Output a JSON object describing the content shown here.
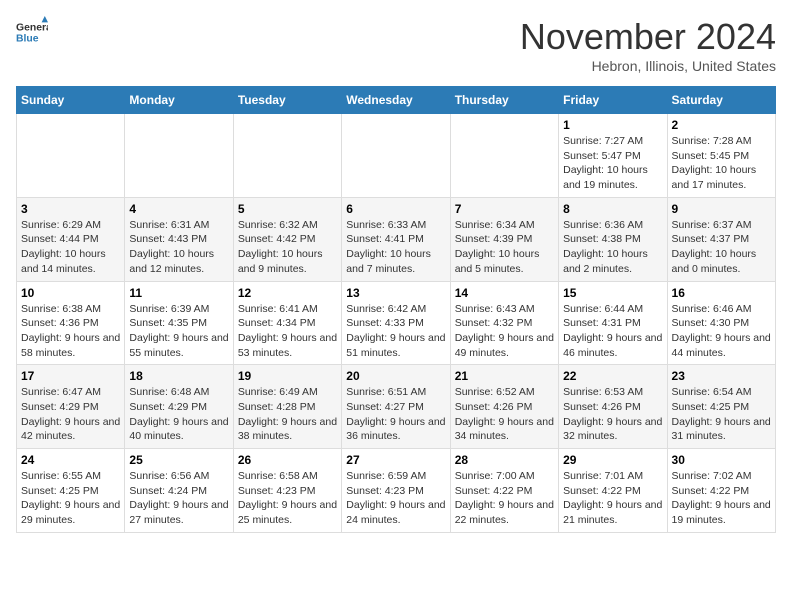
{
  "header": {
    "logo_general": "General",
    "logo_blue": "Blue",
    "month_title": "November 2024",
    "location": "Hebron, Illinois, United States"
  },
  "days_of_week": [
    "Sunday",
    "Monday",
    "Tuesday",
    "Wednesday",
    "Thursday",
    "Friday",
    "Saturday"
  ],
  "weeks": [
    [
      {
        "day": "",
        "info": ""
      },
      {
        "day": "",
        "info": ""
      },
      {
        "day": "",
        "info": ""
      },
      {
        "day": "",
        "info": ""
      },
      {
        "day": "",
        "info": ""
      },
      {
        "day": "1",
        "info": "Sunrise: 7:27 AM\nSunset: 5:47 PM\nDaylight: 10 hours and 19 minutes."
      },
      {
        "day": "2",
        "info": "Sunrise: 7:28 AM\nSunset: 5:45 PM\nDaylight: 10 hours and 17 minutes."
      }
    ],
    [
      {
        "day": "3",
        "info": "Sunrise: 6:29 AM\nSunset: 4:44 PM\nDaylight: 10 hours and 14 minutes."
      },
      {
        "day": "4",
        "info": "Sunrise: 6:31 AM\nSunset: 4:43 PM\nDaylight: 10 hours and 12 minutes."
      },
      {
        "day": "5",
        "info": "Sunrise: 6:32 AM\nSunset: 4:42 PM\nDaylight: 10 hours and 9 minutes."
      },
      {
        "day": "6",
        "info": "Sunrise: 6:33 AM\nSunset: 4:41 PM\nDaylight: 10 hours and 7 minutes."
      },
      {
        "day": "7",
        "info": "Sunrise: 6:34 AM\nSunset: 4:39 PM\nDaylight: 10 hours and 5 minutes."
      },
      {
        "day": "8",
        "info": "Sunrise: 6:36 AM\nSunset: 4:38 PM\nDaylight: 10 hours and 2 minutes."
      },
      {
        "day": "9",
        "info": "Sunrise: 6:37 AM\nSunset: 4:37 PM\nDaylight: 10 hours and 0 minutes."
      }
    ],
    [
      {
        "day": "10",
        "info": "Sunrise: 6:38 AM\nSunset: 4:36 PM\nDaylight: 9 hours and 58 minutes."
      },
      {
        "day": "11",
        "info": "Sunrise: 6:39 AM\nSunset: 4:35 PM\nDaylight: 9 hours and 55 minutes."
      },
      {
        "day": "12",
        "info": "Sunrise: 6:41 AM\nSunset: 4:34 PM\nDaylight: 9 hours and 53 minutes."
      },
      {
        "day": "13",
        "info": "Sunrise: 6:42 AM\nSunset: 4:33 PM\nDaylight: 9 hours and 51 minutes."
      },
      {
        "day": "14",
        "info": "Sunrise: 6:43 AM\nSunset: 4:32 PM\nDaylight: 9 hours and 49 minutes."
      },
      {
        "day": "15",
        "info": "Sunrise: 6:44 AM\nSunset: 4:31 PM\nDaylight: 9 hours and 46 minutes."
      },
      {
        "day": "16",
        "info": "Sunrise: 6:46 AM\nSunset: 4:30 PM\nDaylight: 9 hours and 44 minutes."
      }
    ],
    [
      {
        "day": "17",
        "info": "Sunrise: 6:47 AM\nSunset: 4:29 PM\nDaylight: 9 hours and 42 minutes."
      },
      {
        "day": "18",
        "info": "Sunrise: 6:48 AM\nSunset: 4:29 PM\nDaylight: 9 hours and 40 minutes."
      },
      {
        "day": "19",
        "info": "Sunrise: 6:49 AM\nSunset: 4:28 PM\nDaylight: 9 hours and 38 minutes."
      },
      {
        "day": "20",
        "info": "Sunrise: 6:51 AM\nSunset: 4:27 PM\nDaylight: 9 hours and 36 minutes."
      },
      {
        "day": "21",
        "info": "Sunrise: 6:52 AM\nSunset: 4:26 PM\nDaylight: 9 hours and 34 minutes."
      },
      {
        "day": "22",
        "info": "Sunrise: 6:53 AM\nSunset: 4:26 PM\nDaylight: 9 hours and 32 minutes."
      },
      {
        "day": "23",
        "info": "Sunrise: 6:54 AM\nSunset: 4:25 PM\nDaylight: 9 hours and 31 minutes."
      }
    ],
    [
      {
        "day": "24",
        "info": "Sunrise: 6:55 AM\nSunset: 4:25 PM\nDaylight: 9 hours and 29 minutes."
      },
      {
        "day": "25",
        "info": "Sunrise: 6:56 AM\nSunset: 4:24 PM\nDaylight: 9 hours and 27 minutes."
      },
      {
        "day": "26",
        "info": "Sunrise: 6:58 AM\nSunset: 4:23 PM\nDaylight: 9 hours and 25 minutes."
      },
      {
        "day": "27",
        "info": "Sunrise: 6:59 AM\nSunset: 4:23 PM\nDaylight: 9 hours and 24 minutes."
      },
      {
        "day": "28",
        "info": "Sunrise: 7:00 AM\nSunset: 4:22 PM\nDaylight: 9 hours and 22 minutes."
      },
      {
        "day": "29",
        "info": "Sunrise: 7:01 AM\nSunset: 4:22 PM\nDaylight: 9 hours and 21 minutes."
      },
      {
        "day": "30",
        "info": "Sunrise: 7:02 AM\nSunset: 4:22 PM\nDaylight: 9 hours and 19 minutes."
      }
    ]
  ]
}
